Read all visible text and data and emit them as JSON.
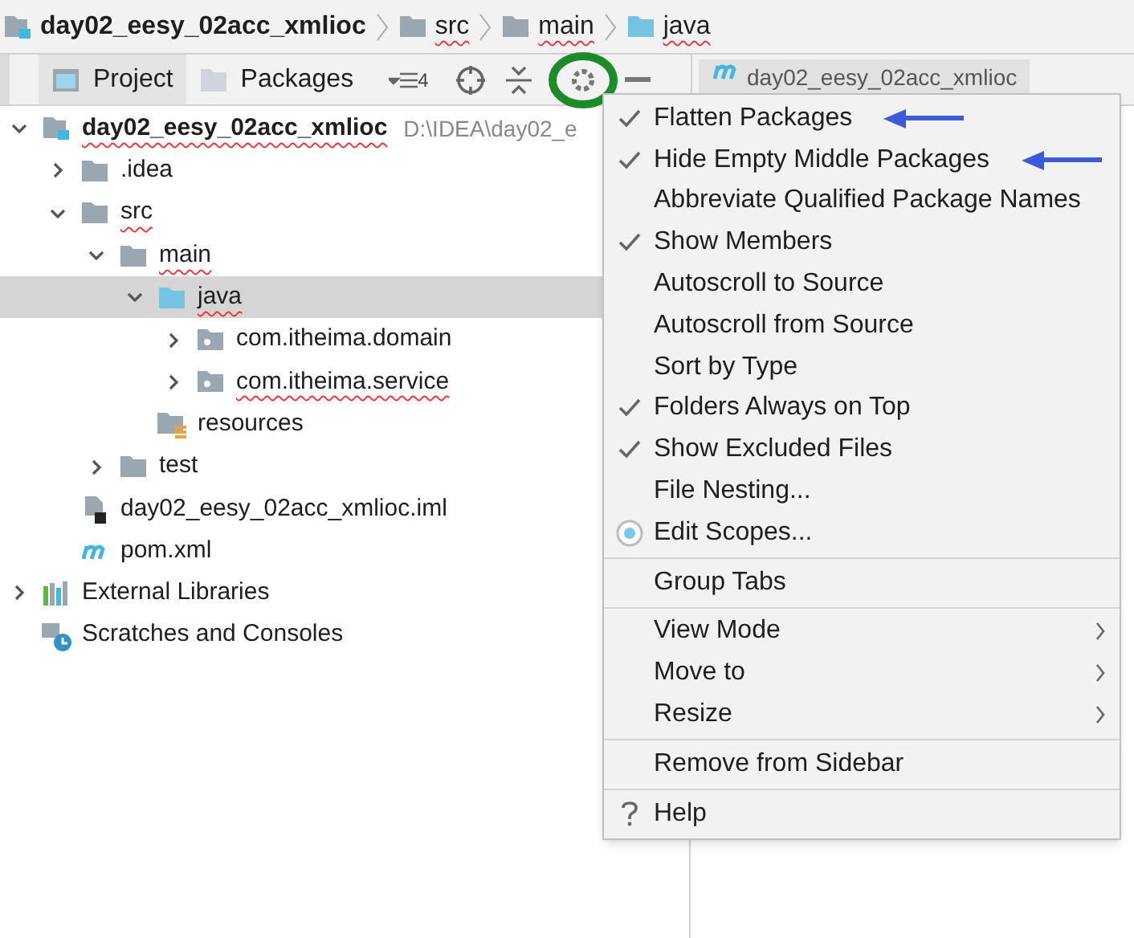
{
  "breadcrumb": [
    {
      "label": "day02_eesy_02acc_xmlioc",
      "kind": "module",
      "bold": true,
      "spell_error": false
    },
    {
      "label": "src",
      "kind": "folder",
      "bold": false,
      "spell_error": true
    },
    {
      "label": "main",
      "kind": "folder",
      "bold": false,
      "spell_error": true
    },
    {
      "label": "java",
      "kind": "source",
      "bold": false,
      "spell_error": true
    }
  ],
  "tool_tabs": [
    {
      "label": "Project",
      "kind": "project",
      "selected": true
    },
    {
      "label": "Packages",
      "kind": "packages",
      "selected": false
    }
  ],
  "scope_count": "4",
  "editor_tab": {
    "label": "day02_eesy_02acc_xmlioc"
  },
  "tree": [
    {
      "label": "day02_eesy_02acc_xmlioc",
      "kind": "module",
      "bold": true,
      "spell_error": true,
      "hint": "D:\\IDEA\\day02_e",
      "expanded": true,
      "selected": false,
      "children": [
        {
          "label": ".idea",
          "kind": "folder",
          "spell_error": false,
          "expanded": false,
          "selected": false
        },
        {
          "label": "src",
          "kind": "folder",
          "spell_error": true,
          "expanded": true,
          "selected": false,
          "children": [
            {
              "label": "main",
              "kind": "folder",
              "spell_error": true,
              "expanded": true,
              "selected": false,
              "children": [
                {
                  "label": "java",
                  "kind": "source",
                  "spell_error": true,
                  "expanded": true,
                  "selected": true,
                  "children": [
                    {
                      "label": "com.itheima.domain",
                      "kind": "package",
                      "spell_error": false,
                      "expanded": false,
                      "selected": false
                    },
                    {
                      "label": "com.itheima.service",
                      "kind": "package",
                      "spell_error": true,
                      "expanded": false,
                      "selected": false
                    }
                  ]
                },
                {
                  "label": "resources",
                  "kind": "resources",
                  "spell_error": false,
                  "selected": false
                }
              ]
            },
            {
              "label": "test",
              "kind": "folder",
              "spell_error": false,
              "expanded": false,
              "selected": false
            }
          ]
        },
        {
          "label": "day02_eesy_02acc_xmlioc.iml",
          "kind": "iml",
          "spell_error": false,
          "selected": false
        },
        {
          "label": "pom.xml",
          "kind": "maven",
          "spell_error": false,
          "selected": false
        }
      ]
    },
    {
      "label": "External Libraries",
      "kind": "libraries",
      "spell_error": false,
      "expanded": false,
      "selected": false
    },
    {
      "label": "Scratches and Consoles",
      "kind": "scratches",
      "spell_error": false,
      "selected": false
    }
  ],
  "menu": {
    "groups": [
      [
        {
          "label": "Flatten Packages",
          "kind": "toggle",
          "checked": true,
          "pointer": true
        },
        {
          "label": "Hide Empty Middle Packages",
          "kind": "toggle",
          "checked": true,
          "pointer": true
        },
        {
          "label": "Abbreviate Qualified Package Names",
          "kind": "toggle",
          "checked": false
        },
        {
          "label": "Show Members",
          "kind": "toggle",
          "checked": true
        },
        {
          "label": "Autoscroll to Source",
          "kind": "toggle",
          "checked": false
        },
        {
          "label": "Autoscroll from Source",
          "kind": "toggle",
          "checked": false
        },
        {
          "label": "Sort by Type",
          "kind": "toggle",
          "checked": false
        },
        {
          "label": "Folders Always on Top",
          "kind": "toggle",
          "checked": true
        },
        {
          "label": "Show Excluded Files",
          "kind": "toggle",
          "checked": true
        },
        {
          "label": "File Nesting...",
          "kind": "toggle",
          "checked": false
        },
        {
          "label": "Edit Scopes...",
          "kind": "scope"
        }
      ],
      [
        {
          "label": "Group Tabs",
          "kind": "toggle",
          "checked": false
        }
      ],
      [
        {
          "label": "View Mode",
          "kind": "submenu"
        },
        {
          "label": "Move to",
          "kind": "submenu"
        },
        {
          "label": "Resize",
          "kind": "submenu"
        }
      ],
      [
        {
          "label": "Remove from Sidebar",
          "kind": "action"
        }
      ],
      [
        {
          "label": "Help",
          "kind": "help"
        }
      ]
    ]
  }
}
